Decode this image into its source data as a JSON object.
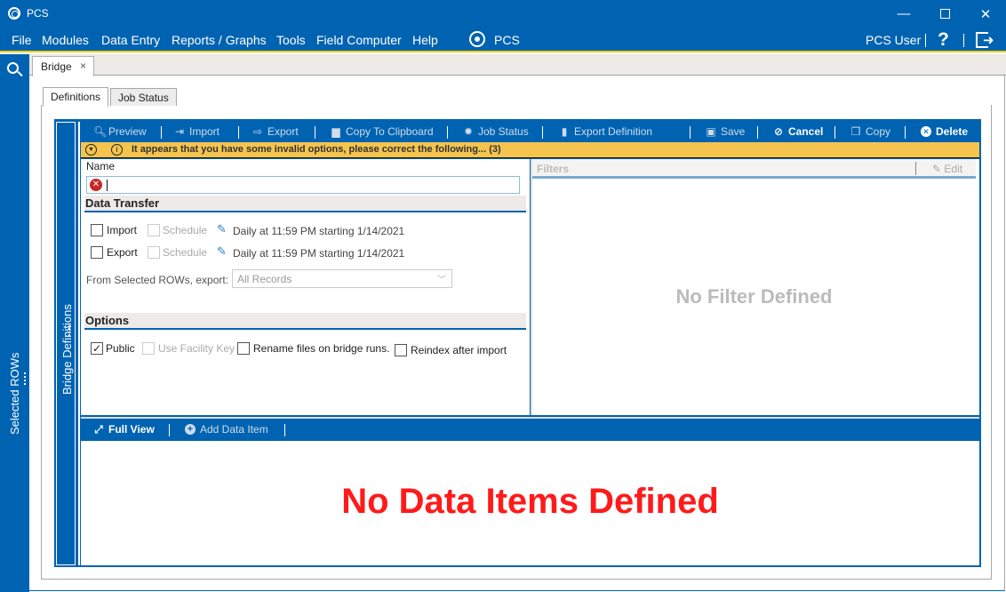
{
  "window": {
    "title": "PCS",
    "controls": {
      "minimize": "—",
      "maximize": "☐",
      "close": "✕"
    }
  },
  "menubar": {
    "items": [
      "File",
      "Modules",
      "Data Entry",
      "Reports / Graphs",
      "Tools",
      "Field Computer",
      "Help"
    ],
    "logo_text": "PCS",
    "user": "PCS User",
    "help": "?",
    "accent_color": "#0063b1",
    "underline_color": "#f0d000"
  },
  "sidebar": {
    "label": "Selected ROWs"
  },
  "doc_tabs": [
    {
      "label": "Bridge",
      "close": "×"
    }
  ],
  "sub_tabs": [
    {
      "label": "Definitions",
      "active": true
    },
    {
      "label": "Job Status",
      "active": false
    }
  ],
  "bridge_panel": {
    "label": "Bridge Definitions"
  },
  "toolbar": {
    "preview": "Preview",
    "import": "Import",
    "export": "Export",
    "copy_clipboard": "Copy To Clipboard",
    "job_status": "Job Status",
    "export_definition": "Export Definition",
    "save": "Save",
    "cancel": "Cancel",
    "copy": "Copy",
    "delete": "Delete"
  },
  "warning": {
    "message": "It appears that you have some invalid options, please correct the following...  (3)",
    "color": "#f4c44e"
  },
  "form": {
    "name_label": "Name",
    "name_value": "",
    "data_transfer": {
      "heading": "Data Transfer",
      "import_label": "Import",
      "import_checked": false,
      "import_schedule_label": "Schedule",
      "import_schedule_text": "Daily at 11:59 PM starting 1/14/2021",
      "export_label": "Export",
      "export_checked": false,
      "export_schedule_label": "Schedule",
      "export_schedule_text": "Daily at 11:59 PM starting 1/14/2021",
      "from_selected_label": "From Selected ROWs, export:",
      "from_selected_value": "All Records"
    },
    "options": {
      "heading": "Options",
      "public_label": "Public",
      "public_checked": true,
      "facility_key_label": "Use Facility Key",
      "rename_label": "Rename files on bridge runs.",
      "reindex_label": "Reindex after import"
    }
  },
  "filters": {
    "heading": "Filters",
    "edit_label": "Edit",
    "empty_text": "No Filter Defined"
  },
  "data_items": {
    "full_view_label": "Full View",
    "add_label": "Add Data Item",
    "empty_text": "No Data Items Defined",
    "empty_color": "#ff1a1a"
  }
}
